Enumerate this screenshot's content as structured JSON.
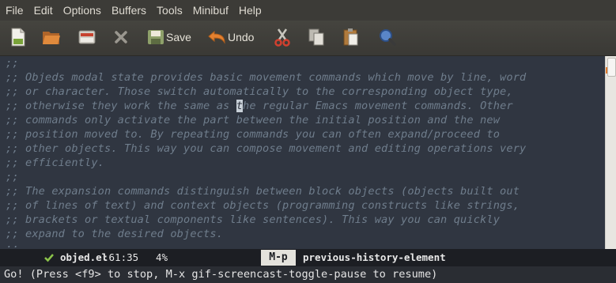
{
  "menubar": {
    "items": [
      "File",
      "Edit",
      "Options",
      "Buffers",
      "Tools",
      "Minibuf",
      "Help"
    ]
  },
  "toolbar": {
    "buttons": [
      {
        "icon": "new-file-icon",
        "label": ""
      },
      {
        "icon": "open-folder-icon",
        "label": ""
      },
      {
        "icon": "close-buffer-icon",
        "label": ""
      },
      {
        "icon": "cancel-icon",
        "label": ""
      },
      {
        "icon": "save-icon",
        "label": "Save"
      },
      {
        "icon": "undo-icon",
        "label": "Undo"
      },
      {
        "icon": "cut-icon",
        "label": ""
      },
      {
        "icon": "copy-icon",
        "label": ""
      },
      {
        "icon": "paste-icon",
        "label": ""
      },
      {
        "icon": "search-icon",
        "label": ""
      }
    ]
  },
  "editor": {
    "lines": [
      ";;",
      ";; Objeds modal state provides basic movement commands which move by line, word",
      ";; or character. Those switch automatically to the corresponding object type,",
      "otherwise they work the same as ",
      ";; commands only activate the part between the initial position and the new",
      ";; position moved to. By repeating commands you can often expand/proceed to",
      ";; other objects. This way you can compose movement and editing operations very",
      ";; efficiently.",
      ";;",
      ";; The expansion commands distinguish between block objects (objects built out",
      ";; of lines of text) and context objects (programming constructs like strings,",
      ";; brackets or textual components like sentences). This way you can quickly",
      ";; expand to the desired objects.",
      ";;"
    ],
    "cursor_line": {
      "prefix": ";; otherwise they work the same as ",
      "cursor_char": "t",
      "suffix": "he regular Emacs movement commands. Other"
    }
  },
  "modeline": {
    "buffer_name": "objed.el",
    "position": ":61:35",
    "percent": "4%",
    "key": "M-p",
    "command": "previous-history-element"
  },
  "echo_area": {
    "message": "Go! (Press <f9> to stop, M-x gif-screencast-toggle-pause to resume)"
  }
}
